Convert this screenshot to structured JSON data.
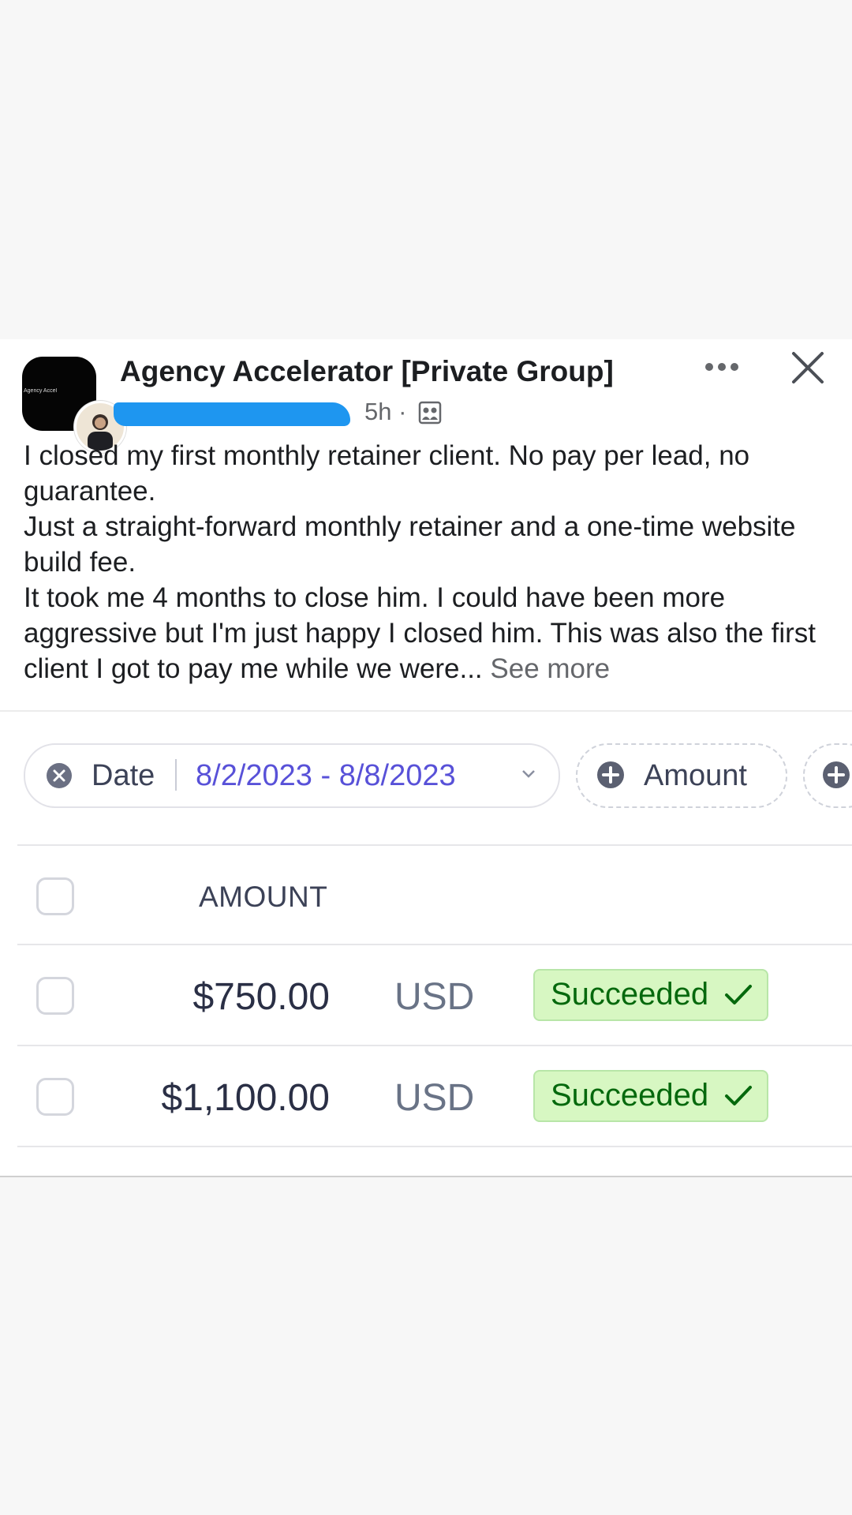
{
  "post": {
    "group_name": "Agency Accelerator [Private Group]",
    "group_avatar_text": "Agency Accel",
    "time_ago": "5h ·",
    "body_lines": [
      "I closed my first monthly retainer client.  No pay per lead, no guarantee.",
      "Just a straight-forward monthly retainer and a one-time website build fee.",
      "It took me 4 months to close him.  I could have been more aggressive but I'm just happy I closed him.  This was also the first client I got to pay me while we were..."
    ],
    "see_more": "See more"
  },
  "filters": {
    "date_label": "Date",
    "date_range": "8/2/2023 - 8/8/2023",
    "amount_label": "Amount"
  },
  "table": {
    "header": "AMOUNT",
    "rows": [
      {
        "amount": "$750.00",
        "currency": "USD",
        "status": "Succeeded"
      },
      {
        "amount": "$1,100.00",
        "currency": "USD",
        "status": "Succeeded"
      }
    ]
  },
  "colors": {
    "accent_blue": "#1e96f0",
    "date_purple": "#5851d8",
    "status_bg": "#d7f7c2",
    "status_text": "#05690d"
  }
}
